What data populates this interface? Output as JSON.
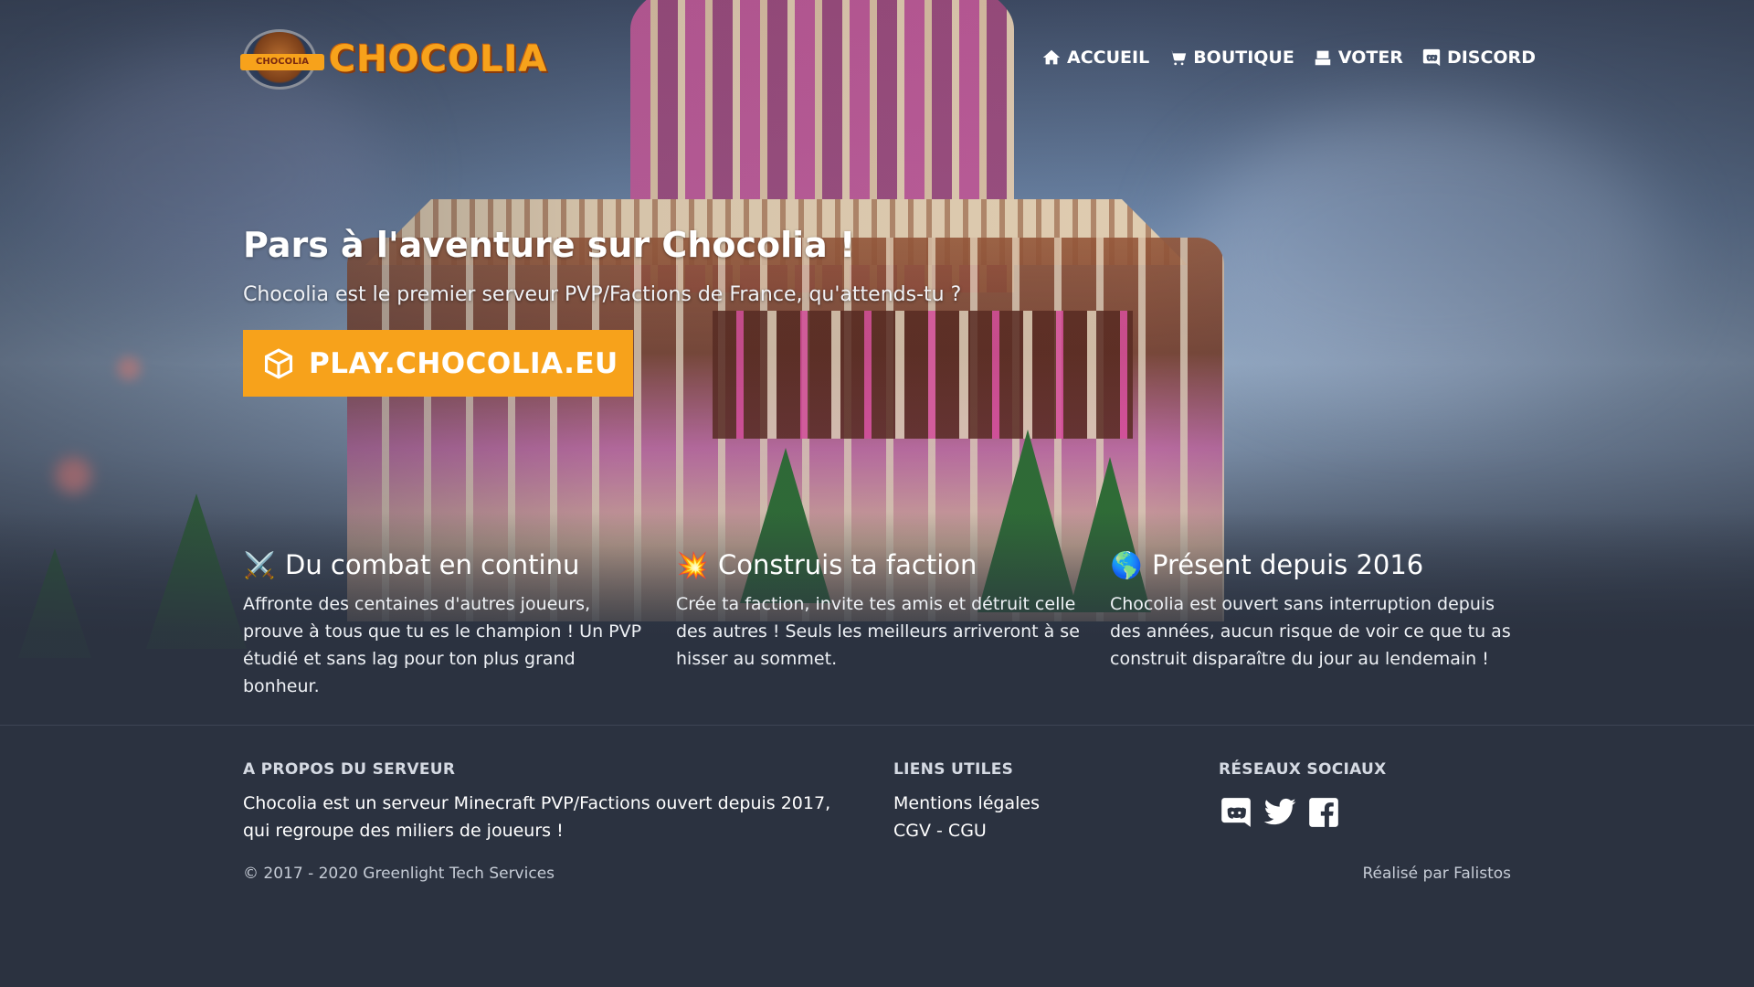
{
  "brand": {
    "name": "CHOCOLIA",
    "badge_text": "CHOCOLIA",
    "accent_color": "#f7a21b"
  },
  "nav": [
    {
      "label": "ACCUEIL",
      "icon": "home-icon"
    },
    {
      "label": "BOUTIQUE",
      "icon": "cart-icon"
    },
    {
      "label": "VOTER",
      "icon": "vote-icon"
    },
    {
      "label": "DISCORD",
      "icon": "discord-icon"
    }
  ],
  "hero": {
    "title": "Pars à l'aventure sur Chocolia !",
    "subtitle": "Chocolia est le premier serveur PVP/Factions de France, qu'attends-tu ?",
    "play_button": "PLAY.CHOCOLIA.EU",
    "play_icon": "cube-icon"
  },
  "features": [
    {
      "emoji": "⚔️",
      "icon": "crossed-swords-icon",
      "title": "Du combat en continu",
      "text": "Affronte des centaines d'autres joueurs, prouve à tous que tu es le champion ! Un PVP étudié et sans lag pour ton plus grand bonheur."
    },
    {
      "emoji": "💥",
      "icon": "explosion-icon",
      "title": "Construis ta faction",
      "text": "Crée ta faction, invite tes amis et détruit celle des autres ! Seuls les meilleurs arriveront à se hisser au sommet."
    },
    {
      "emoji": "🌎",
      "icon": "globe-icon",
      "title": "Présent depuis 2016",
      "text": "Chocolia est ouvert sans interruption depuis des années, aucun risque de voir ce que tu as construit disparaître du jour au lendemain !"
    }
  ],
  "footer": {
    "about": {
      "heading": "A PROPOS DU SERVEUR",
      "text": "Chocolia est un serveur Minecraft PVP/Factions ouvert depuis 2017, qui regroupe des miliers de joueurs !"
    },
    "links": {
      "heading": "LIENS UTILES",
      "items": [
        "Mentions légales",
        "CGV - CGU"
      ]
    },
    "social": {
      "heading": "RÉSEAUX SOCIAUX",
      "icons": [
        "discord-icon",
        "twitter-icon",
        "facebook-icon"
      ]
    },
    "copyright": "© 2017 - 2020 Greenlight Tech Services",
    "credit": "Réalisé par Falistos"
  }
}
